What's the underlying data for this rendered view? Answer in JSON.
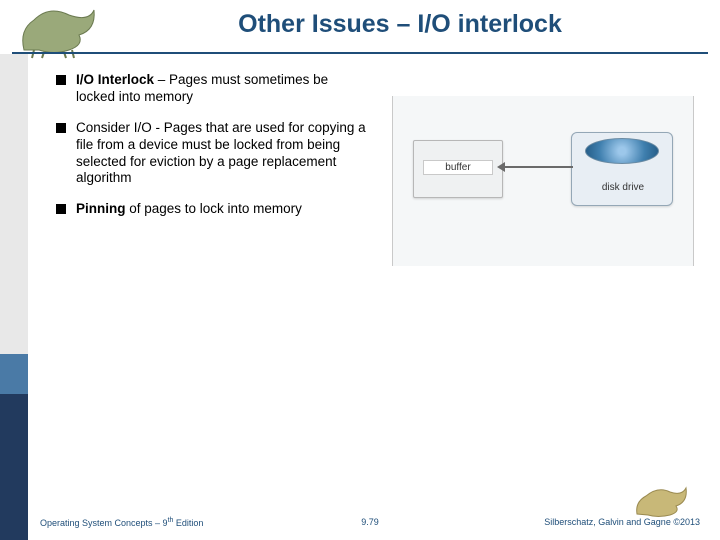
{
  "title": "Other Issues – I/O interlock",
  "bullets": [
    {
      "strong": "I/O Interlock",
      "rest": " – Pages must sometimes be locked into memory"
    },
    {
      "plain": "Consider I/O - Pages that are used for copying a file from a device must be locked from being selected for eviction by a page replacement algorithm"
    },
    {
      "strong": "Pinning",
      "rest": " of pages to lock into memory"
    }
  ],
  "figure": {
    "buffer_label": "buffer",
    "disk_label": "disk drive"
  },
  "footer": {
    "left_pre": "Operating System Concepts – 9",
    "left_sup": "th",
    "left_post": " Edition",
    "center": "9.79",
    "right_pre": "Silberschatz, Galvin and Gagne ",
    "right_copy": "©",
    "right_year": "2013"
  }
}
